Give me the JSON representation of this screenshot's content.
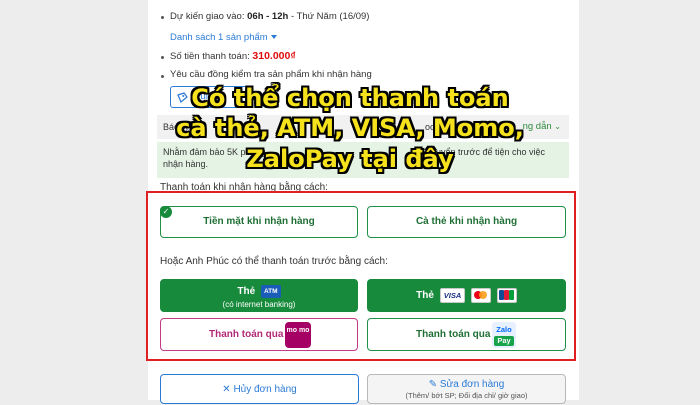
{
  "delivery": {
    "prefix": "Dự kiến giao vào: ",
    "time": "06h - 12h",
    "day": " - Thứ Năm (16/09)"
  },
  "product_list_label": "Danh sách 1 sản phẩm",
  "payment_total": {
    "label": "Số tiền thanh toán: ",
    "amount": "310.000₫"
  },
  "inspect_request": "Yêu cầu đồng kiểm tra sản phẩm khi nhận hàng",
  "coupon_button": "Dùng",
  "gray_notice": {
    "text": "Bách ho",
    "tail": "ook",
    "more": "ng dẫn"
  },
  "green_notice": {
    "line1_start": "Nhằm đảm bảo 5K phòng",
    "line1_end": "ruyển trước để tiện cho việc",
    "line2": "nhận hàng."
  },
  "cod_heading": "Thanh toán khi nhận hàng bằng cách:",
  "cod_options": {
    "cash": "Tiền mặt khi nhận hàng",
    "card": "Cà thẻ khi nhận hàng"
  },
  "prepay_heading": "Hoặc Anh Phúc có thể thanh toán trước bằng cách:",
  "prepay_options": {
    "atm_label": "Thẻ",
    "atm_badge": "ATM",
    "atm_sub": "(có internet banking)",
    "intl_label": "Thẻ",
    "visa_badge": "VISA",
    "momo_label": "Thanh toán qua",
    "momo_logo": "mo mo",
    "zalo_label": "Thanh toán qua",
    "zalo_logo_top": "Zalo",
    "zalo_logo_bottom": "Pay"
  },
  "bottom_buttons": {
    "cancel": "Hủy đơn hàng",
    "edit": "Sửa đơn hàng",
    "edit_sub": "(Thêm/ bớt SP; Đổi địa chỉ/ giờ giao)"
  },
  "overlay_caption": {
    "line1": "Có thể chọn thanh toán",
    "line2": "cà thẻ, ATM, VISA, Momo,",
    "line3": "ZaloPay tại đây"
  },
  "colors": {
    "accent_green": "#188a3c",
    "highlight_red": "#e02020",
    "price_red": "#e00d0d",
    "link_blue": "#2b7bd6",
    "momo_pink": "#a50064",
    "caption_yellow": "#f5e11c"
  }
}
